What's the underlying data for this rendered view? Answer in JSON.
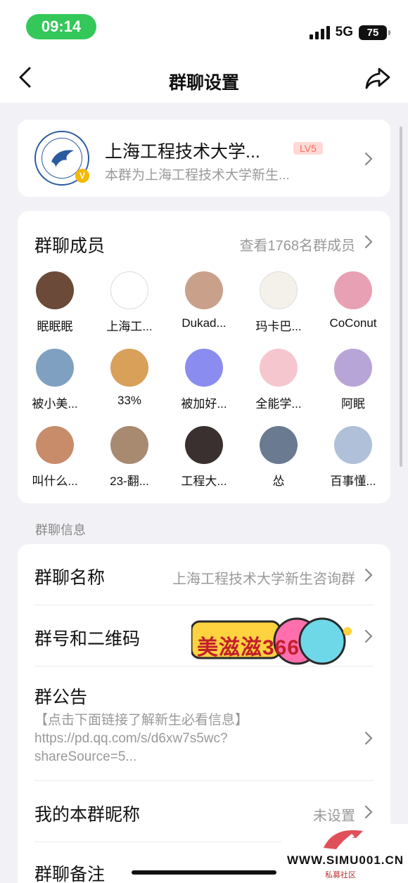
{
  "status_bar": {
    "time": "09:14",
    "network": "5G",
    "battery": "75"
  },
  "nav": {
    "title": "群聊设置",
    "back_icon": "chevron-left-icon",
    "share_icon": "share-icon"
  },
  "group": {
    "name": "上海工程技术大学...",
    "level": "LV5",
    "description": "本群为上海工程技术大学新生...",
    "verified_badge": "V"
  },
  "members": {
    "title": "群聊成员",
    "view_all": "查看1768名群成员",
    "list": [
      {
        "name": "眠眠眠",
        "color": "#6b4a3a"
      },
      {
        "name": "上海工...",
        "color": "#ffffff"
      },
      {
        "name": "Dukad...",
        "color": "#c9a08a"
      },
      {
        "name": "玛卡巴...",
        "color": "#f4f1ea"
      },
      {
        "name": "CoConut",
        "color": "#e8a0b4"
      },
      {
        "name": "被小美...",
        "color": "#7fa0c0"
      },
      {
        "name": "33%",
        "color": "#d9a05a"
      },
      {
        "name": "被加好...",
        "color": "#8a8cf0"
      },
      {
        "name": "全能学...",
        "color": "#f6c6cf"
      },
      {
        "name": "阿眠",
        "color": "#b8a5d8"
      },
      {
        "name": "叫什么...",
        "color": "#c88c6a"
      },
      {
        "name": "23-翻...",
        "color": "#a88a70"
      },
      {
        "name": "工程大...",
        "color": "#3a3030"
      },
      {
        "name": "怂",
        "color": "#6a7a90"
      },
      {
        "name": "百事懂...",
        "color": "#b0c0d8"
      }
    ]
  },
  "info_section_label": "群聊信息",
  "info": {
    "group_name_label": "群聊名称",
    "group_name_value": "上海工程技术大学新生咨询群",
    "qr_label": "群号和二维码",
    "notice_label": "群公告",
    "notice_line1": "【点击下面链接了解新生必看信息】",
    "notice_line2": "https://pd.qq.com/s/d6xw7s5wc?",
    "notice_line3": "shareSource=5...",
    "nickname_label": "我的本群昵称",
    "nickname_value": "未设置",
    "remark_label": "群聊备注"
  },
  "sticker_text": "美滋滋366",
  "watermark": {
    "text": "WWW.SIMU001.CN",
    "sub": "私募社区"
  },
  "colors": {
    "accent_green": "#34c759",
    "level_badge_bg": "#ffd9d6",
    "level_badge_text": "#ff6b5e"
  }
}
